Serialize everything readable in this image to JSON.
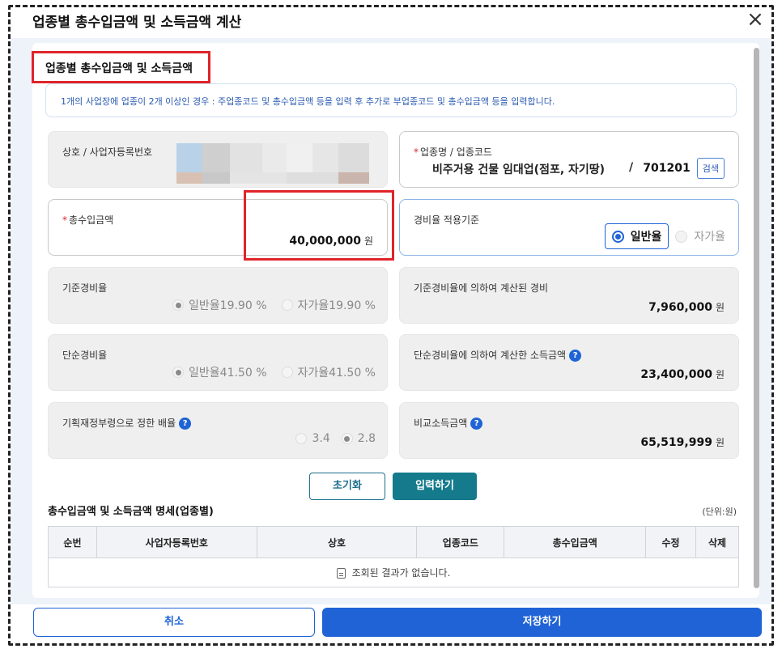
{
  "modal": {
    "title": "업종별 총수입금액 및 소득금액 계산",
    "close_label": "×"
  },
  "section": {
    "title": "업종별 총수입금액 및 소득금액"
  },
  "info": {
    "text": "1개의 사업장에 업종이 2개 이상인 경우 : 주업종코드 및 총수입금액 등을 입력 후 추가로 부업종코드 및 총수입금액 등을 입력합니다."
  },
  "business": {
    "label": "상호 / 사업자등록번호"
  },
  "industry": {
    "required_mark": "*",
    "label": "업종명 / 업종코드",
    "name": "비주거용 건물 임대업(점포, 자기땅)",
    "separator": "/",
    "code": "701201",
    "search_label": "검색"
  },
  "revenue": {
    "required_mark": "*",
    "label": "총수입금액",
    "value": "40,000,000",
    "unit": "원"
  },
  "expense_basis": {
    "label": "경비율 적용기준",
    "options": [
      "일반율",
      "자가율"
    ],
    "selected": "일반율"
  },
  "standard_rate": {
    "label": "기준경비율",
    "option1": "일반율19.90 %",
    "option2": "자가율19.90 %"
  },
  "standard_expense": {
    "label": "기준경비율에 의하여 계산된 경비",
    "value": "7,960,000",
    "unit": "원"
  },
  "simple_rate": {
    "label": "단순경비율",
    "option1": "일반율41.50 %",
    "option2": "자가율41.50 %"
  },
  "simple_income": {
    "label": "단순경비율에 의하여 계산한 소득금액",
    "help": "?",
    "value": "23,400,000",
    "unit": "원"
  },
  "multiplier": {
    "label": "기획재정부령으로 정한 배율",
    "help": "?",
    "option1": "3.4",
    "option2": "2.8"
  },
  "compare_income": {
    "label": "비교소득금액",
    "help": "?",
    "value": "65,519,999",
    "unit": "원"
  },
  "actions": {
    "reset": "초기화",
    "input": "입력하기"
  },
  "table": {
    "title": "총수입금액 및 소득금액 명세(업종별)",
    "unit": "(단위:원)",
    "headers": [
      "순번",
      "사업자등록번호",
      "상호",
      "업종코드",
      "총수입금액",
      "수정",
      "삭제"
    ],
    "empty_message": "조회된 결과가 없습니다."
  },
  "footer": {
    "cancel": "취소",
    "save": "저장하기"
  },
  "colors": {
    "primary": "#1f63d6",
    "teal": "#147a8c",
    "highlight": "#e0242a"
  }
}
